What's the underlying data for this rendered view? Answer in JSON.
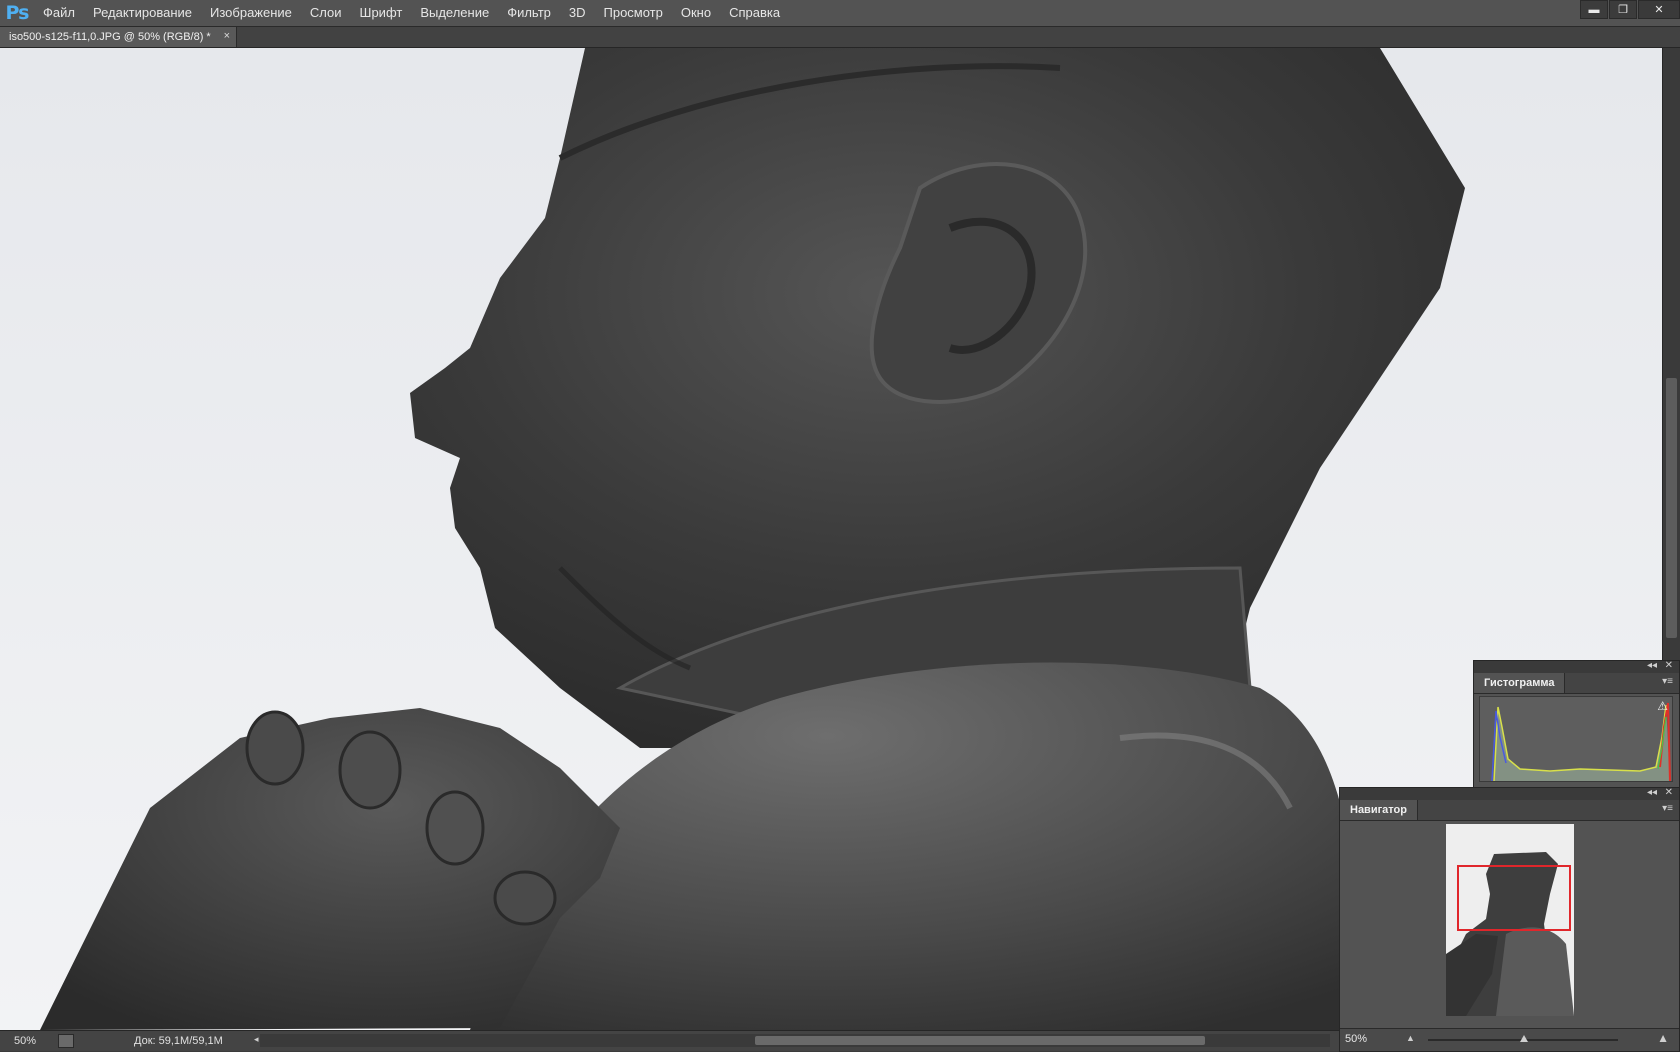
{
  "app": {
    "logo": "Ps"
  },
  "menu": [
    "Файл",
    "Редактирование",
    "Изображение",
    "Слои",
    "Шрифт",
    "Выделение",
    "Фильтр",
    "3D",
    "Просмотр",
    "Окно",
    "Справка"
  ],
  "window_controls": {
    "minimize": "▬",
    "restore": "❐",
    "close": "✕"
  },
  "document": {
    "tab_title": "iso500-s125-f11,0.JPG @ 50% (RGB/8) *",
    "tab_close": "×"
  },
  "status": {
    "zoom": "50%",
    "doc_info": "Док: 59,1M/59,1M",
    "arrow": "▶"
  },
  "histogram_panel": {
    "title": "Гистограмма",
    "warning_icon": "⚠",
    "collapse": "◂◂",
    "close": "✕",
    "menu": "▾≡"
  },
  "navigator_panel": {
    "title": "Навигатор",
    "zoom": "50%",
    "collapse": "◂◂",
    "close": "✕",
    "menu": "▾≡",
    "view_color": "#e0262b"
  },
  "colors": {
    "accent_logo": "#4fb0f2",
    "panel_bg": "#535353",
    "menubar_bg": "#535353"
  }
}
